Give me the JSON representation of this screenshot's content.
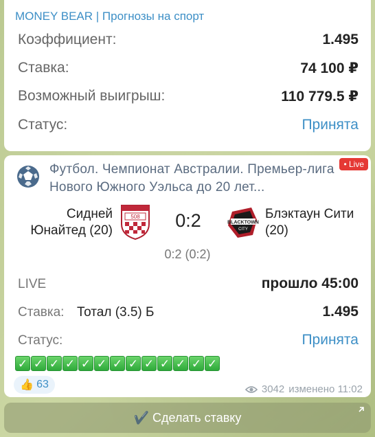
{
  "channel": "MONEY BEAR | Прогнозы на спорт",
  "summary": {
    "rows": [
      {
        "label": "Коэффициент:",
        "value": "1.495"
      },
      {
        "label": "Ставка:",
        "value": "74 100 ₽"
      },
      {
        "label": "Возможный выигрыш:",
        "value": "110 779.5 ₽"
      },
      {
        "label": "Статус:",
        "value": "Принята"
      }
    ]
  },
  "match": {
    "title": "Футбол. Чемпионат Австралии. Премьер-лига Нового Южного Уэльса до 20 лет...",
    "live_badge": "• Live",
    "home_team": "Сидней Юнайтед (20)",
    "away_team": "Блэктаун Сити (20)",
    "score": "0:2",
    "halftime": "0:2 (0:2)",
    "live_label": "LIVE",
    "elapsed": "прошло 45:00",
    "bet_label": "Ставка:",
    "bet_value": "Тотал (3.5) Б",
    "bet_odds": "1.495",
    "status_label": "Статус:",
    "status_value": "Принята",
    "checks": [
      "✓",
      "✓",
      "✓",
      "✓",
      "✓",
      "✓",
      "✓",
      "✓",
      "✓",
      "✓",
      "✓",
      "✓",
      "✓"
    ],
    "reaction_emoji": "👍",
    "reaction_count": "63",
    "views": "3042",
    "edited": "изменено 11:02"
  },
  "action": {
    "label": "✔️ Сделать ставку"
  },
  "colors": {
    "accent": "#3d8fc6",
    "live": "#e53935",
    "check": "#2eaa3a"
  }
}
